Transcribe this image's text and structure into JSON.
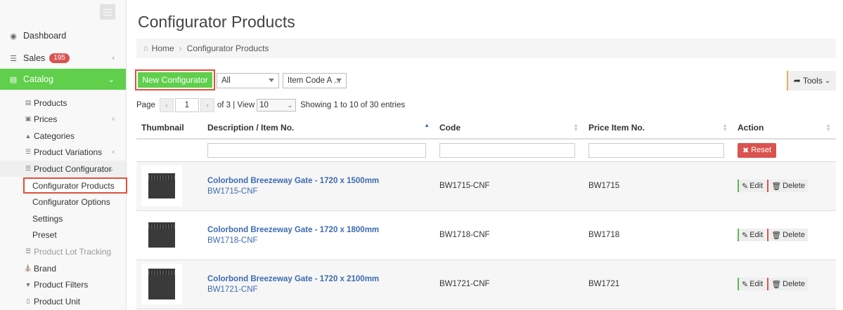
{
  "sidebar": {
    "top_items": [
      {
        "label": "Dashboard",
        "icon": "dashboard-icon"
      },
      {
        "label": "Sales",
        "icon": "list-icon",
        "badge": "195"
      },
      {
        "label": "Catalog",
        "icon": "catalog-icon"
      }
    ],
    "catalog_items": [
      {
        "label": "Products"
      },
      {
        "label": "Prices"
      },
      {
        "label": "Categories"
      },
      {
        "label": "Product Variations"
      },
      {
        "label": "Product Configurator"
      }
    ],
    "configurator_items": [
      {
        "label": "Configurator Products"
      },
      {
        "label": "Configurator Options"
      },
      {
        "label": "Settings"
      },
      {
        "label": "Preset"
      }
    ],
    "more_items": [
      {
        "label": "Product Lot Tracking"
      },
      {
        "label": "Brand"
      },
      {
        "label": "Product Filters"
      },
      {
        "label": "Product Unit"
      }
    ]
  },
  "main": {
    "title": "Configurator Products",
    "breadcrumb": {
      "home": "Home",
      "current": "Configurator Products"
    },
    "toolbar": {
      "new_label": "New Configurator",
      "filter_all": "All",
      "filter_code": "Item Code A ...",
      "tools_label": "Tools"
    },
    "pager": {
      "page_label": "Page",
      "page_value": "1",
      "of_text": "of 3 | View",
      "per_page": "10",
      "showing": "Showing 1 to 10 of 30 entries"
    },
    "table": {
      "headers": {
        "thumbnail": "Thumbnail",
        "description": "Description / Item No.",
        "code": "Code",
        "price_item": "Price Item No.",
        "action": "Action"
      },
      "reset_label": "Reset",
      "edit_label": "Edit",
      "delete_label": "Delete",
      "rows": [
        {
          "title": "Colorbond Breezeway Gate - 1720 x 1500mm",
          "item_no": "BW1715-CNF",
          "code": "BW1715-CNF",
          "price_item": "BW1715"
        },
        {
          "title": "Colorbond Breezeway Gate - 1720 x 1800mm",
          "item_no": "BW1718-CNF",
          "code": "BW1718-CNF",
          "price_item": "BW1718"
        },
        {
          "title": "Colorbond Breezeway Gate - 1720 x 2100mm",
          "item_no": "BW1721-CNF",
          "code": "BW1721-CNF",
          "price_item": "BW1721"
        }
      ]
    }
  },
  "colors": {
    "accent_green": "#5fcf4c",
    "highlight_red": "#e0503a",
    "link_blue": "#3c6bb0",
    "badge_red": "#d9534f"
  }
}
